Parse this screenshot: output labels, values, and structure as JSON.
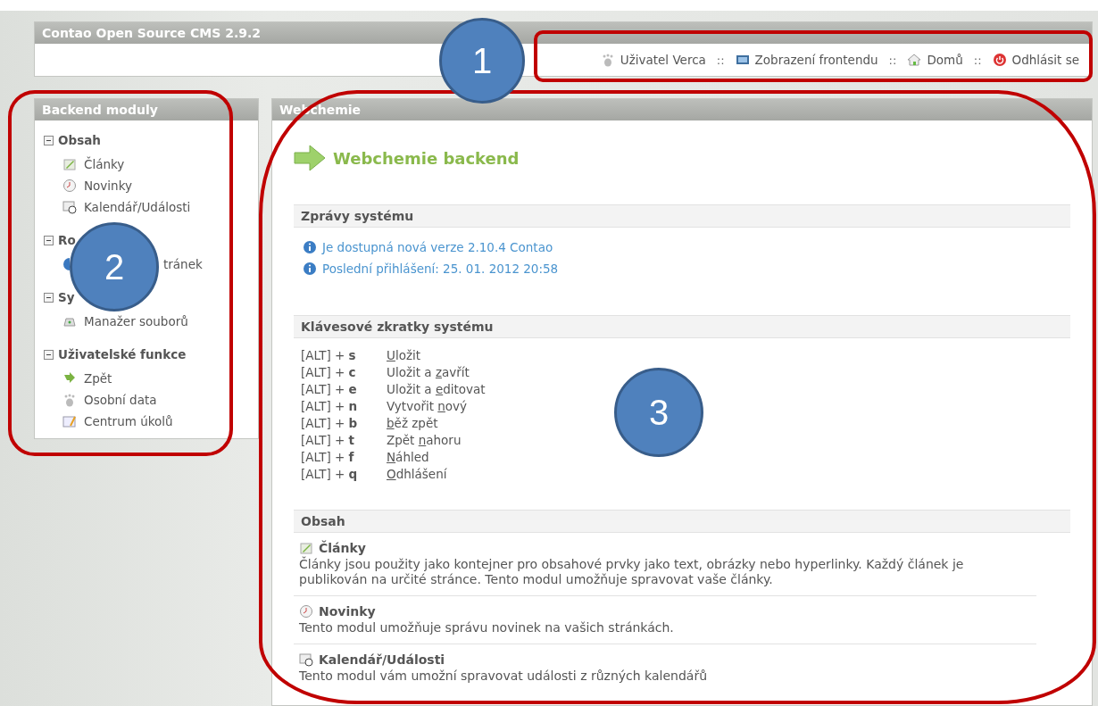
{
  "header": {
    "title": "Contao Open Source CMS 2.9.2",
    "links": [
      {
        "label": "Uživatel Verca"
      },
      {
        "label": "Zobrazení frontendu"
      },
      {
        "label": "Domů"
      },
      {
        "label": "Odhlásit se"
      }
    ],
    "separator": "::"
  },
  "sidebar": {
    "title": "Backend moduly",
    "groups": [
      {
        "label": "Obsah",
        "expanded": true,
        "items": [
          {
            "label": "Články",
            "kind": "normal"
          },
          {
            "label": "Novinky",
            "kind": "normal"
          },
          {
            "label": "Kalendář/Události",
            "kind": "normal"
          }
        ]
      },
      {
        "label": "Ro",
        "expanded": true,
        "items": [
          {
            "label": "tránek",
            "kind": "partly-covered"
          }
        ]
      },
      {
        "label": "Sy",
        "expanded": true,
        "items": [
          {
            "label": "Manažer souborů",
            "kind": "normal"
          }
        ]
      },
      {
        "label": "Uživatelské funkce",
        "expanded": true,
        "items": [
          {
            "label": "Zpět",
            "kind": "normal"
          },
          {
            "label": "Osobní data",
            "kind": "normal"
          },
          {
            "label": "Centrum úkolů",
            "kind": "normal"
          }
        ]
      }
    ]
  },
  "main": {
    "title": "Webchemie",
    "heading": "Webchemie backend",
    "messages_section": {
      "title": "Zprávy systému",
      "messages": [
        "Je dostupná nová verze 2.10.4 Contao",
        "Poslední přihlášení: 25. 01. 2012 20:58"
      ]
    },
    "shortcuts_section": {
      "title": "Klávesové zkratky systému",
      "shortcuts": [
        {
          "keys": "[ALT] + **s**",
          "accel": "U",
          "post": "ložit"
        },
        {
          "keys": "[ALT] + **c**",
          "pre": "Uložit a ",
          "accel": "z",
          "post": "avřít"
        },
        {
          "keys": "[ALT] + **e**",
          "pre": "Uložit a ",
          "accel": "e",
          "post": "ditovat"
        },
        {
          "keys": "[ALT] + **n**",
          "pre": "Vytvořit ",
          "accel": "n",
          "post": "ový"
        },
        {
          "keys": "[ALT] + **b**",
          "accel": "b",
          "post": "ěž zpět"
        },
        {
          "keys": "[ALT] + **t**",
          "pre": "Zpět ",
          "accel": "n",
          "post": "ahoru"
        },
        {
          "keys": "[ALT] + **f**",
          "accel": "N",
          "post": "áhled"
        },
        {
          "keys": "[ALT] + **q**",
          "accel": "O",
          "post": "dhlášení"
        }
      ]
    },
    "modules_section": {
      "title": "Obsah",
      "modules": [
        {
          "title": "Články",
          "description": "Články jsou použity jako kontejner pro obsahové prvky jako text, obrázky nebo hyperlinky. Každý článek je publikován na určité stránce. Tento modul umožňuje spravovat vaše články."
        },
        {
          "title": "Novinky",
          "description": "Tento modul umožňuje správu novinek na vašich stránkách."
        },
        {
          "title": "Kalendář/Události",
          "description": "Tento modul vám umožní spravovat události z různých kalendářů"
        }
      ]
    }
  },
  "callouts": [
    {
      "number": "1"
    },
    {
      "number": "2"
    },
    {
      "number": "3"
    }
  ]
}
